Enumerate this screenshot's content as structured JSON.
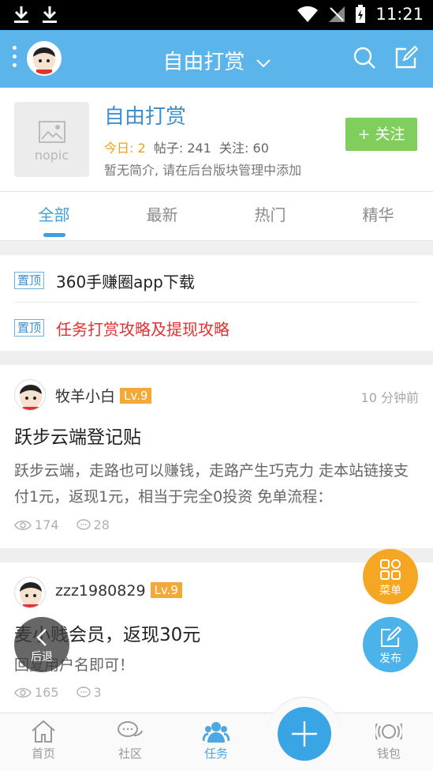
{
  "status_bar": {
    "time": "11:21"
  },
  "app_bar": {
    "title": "自由打赏"
  },
  "forum": {
    "placeholder_image_text": "nopic",
    "name": "自由打赏",
    "today_label": "今日: 2",
    "posts_label": "帖子: 241",
    "follows_label": "关注: 60",
    "description": "暂无简介, 请在后台版块管理中添加",
    "follow_button": "+ 关注"
  },
  "tabs": [
    {
      "label": "全部",
      "active": true
    },
    {
      "label": "最新",
      "active": false
    },
    {
      "label": "热门",
      "active": false
    },
    {
      "label": "精华",
      "active": false
    }
  ],
  "pinned": [
    {
      "badge": "置顶",
      "text": "360手赚圈app下载",
      "color": "#222222"
    },
    {
      "badge": "置顶",
      "text": "任务打赏攻略及提现攻略",
      "color": "#e43030"
    }
  ],
  "posts": [
    {
      "author": "牧羊小白",
      "level": "Lv.9",
      "time": "10 分钟前",
      "title": "跃步云端登记贴",
      "body": "跃步云端，走路也可以赚钱，走路产生巧克力 走本站链接支付1元，返现1元，相当于完全0投资 免单流程：",
      "views": "174",
      "comments": "28"
    },
    {
      "author": "zzz1980829",
      "level": "Lv.9",
      "time": "",
      "title": "麦小贱会员，返现30元",
      "body": "回复用户名即可！",
      "views": "165",
      "comments": "3"
    }
  ],
  "fabs": {
    "menu": "菜单",
    "publish": "发布",
    "back": "后退"
  },
  "bottom_nav": [
    {
      "label": "首页",
      "icon": "home-icon",
      "active": false
    },
    {
      "label": "社区",
      "icon": "community-icon",
      "active": false
    },
    {
      "label": "任务",
      "icon": "task-icon",
      "active": true
    },
    {
      "label": "钱包",
      "icon": "wallet-icon",
      "active": false
    }
  ],
  "colors": {
    "primary": "#5bb4ea",
    "accent_orange": "#f5a623",
    "follow_green": "#7fce5e",
    "pinned_red": "#e43030"
  }
}
